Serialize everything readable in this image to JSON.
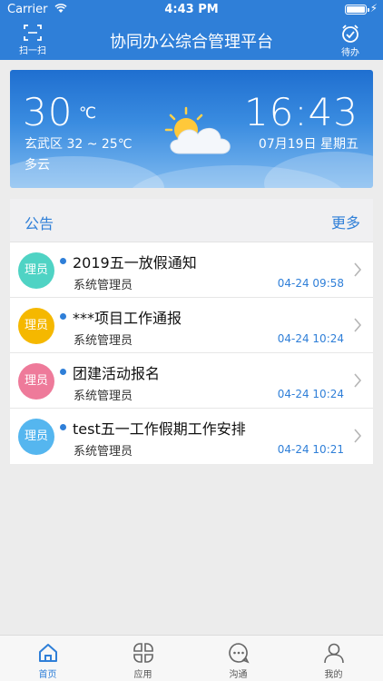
{
  "status_bar": {
    "carrier": "Carrier",
    "time": "4:43 PM"
  },
  "nav": {
    "title": "协同办公综合管理平台",
    "left_label": "扫一扫",
    "left_icon": "scan-icon",
    "right_label": "待办",
    "right_icon": "todo-clock-icon"
  },
  "weather": {
    "temp": "30",
    "unit": "℃",
    "range": "玄武区 32 ~ 25℃",
    "desc": "多云",
    "time": "16:43",
    "date": "07月19日 星期五",
    "icon": "partly-cloudy-icon"
  },
  "notice": {
    "title": "公告",
    "more": "更多",
    "items": [
      {
        "avatar": "理员",
        "avatar_color": "#4fd3c4",
        "title": "2019五一放假通知",
        "author": "系统管理员",
        "time": "04-24 09:58"
      },
      {
        "avatar": "理员",
        "avatar_color": "#f5b800",
        "title": "***项目工作通报",
        "author": "系统管理员",
        "time": "04-24 10:24"
      },
      {
        "avatar": "理员",
        "avatar_color": "#ee7a9a",
        "title": "团建活动报名",
        "author": "系统管理员",
        "time": "04-24 10:24"
      },
      {
        "avatar": "理员",
        "avatar_color": "#55b6ef",
        "title": "test五一工作假期工作安排",
        "author": "系统管理员",
        "time": "04-24 10:21"
      }
    ]
  },
  "tabs": [
    {
      "label": "首页",
      "icon": "home-icon",
      "active": true
    },
    {
      "label": "应用",
      "icon": "apps-icon",
      "active": false
    },
    {
      "label": "沟通",
      "icon": "chat-icon",
      "active": false
    },
    {
      "label": "我的",
      "icon": "profile-icon",
      "active": false
    }
  ],
  "colors": {
    "primary": "#2f7fd8",
    "tab_bar_bg": "#f7f7f7",
    "page_bg": "#ececec"
  }
}
